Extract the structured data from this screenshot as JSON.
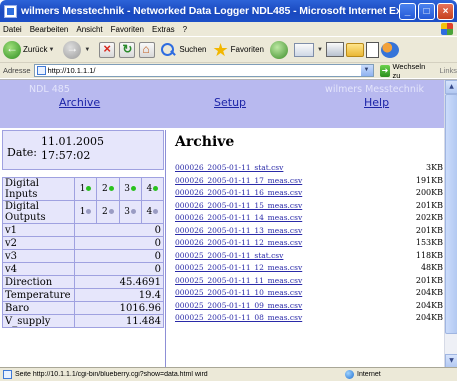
{
  "window": {
    "title": "wilmers Messtechnik - Networked Data Logger NDL485 - Microsoft Internet Explorer",
    "min": "_",
    "max": "□",
    "close": "×"
  },
  "menu": [
    "Datei",
    "Bearbeiten",
    "Ansicht",
    "Favoriten",
    "Extras",
    "?"
  ],
  "toolbar": {
    "back": "Zurück",
    "search": "Suchen",
    "favorites": "Favoriten"
  },
  "address": {
    "label": "Adresse",
    "url": "http://10.1.1.1/",
    "go": "Wechseln zu",
    "links": "Links"
  },
  "header": {
    "device": "NDL 485",
    "brand": "wilmers Messtechnik",
    "nav": {
      "archive": "Archive",
      "setup": "Setup",
      "help": "Help"
    }
  },
  "status_panel": {
    "date_label": "Date:",
    "date": "11.01.2005",
    "time": "17:57:02",
    "digital_inputs_label": "Digital Inputs",
    "digital_outputs_label": "Digital Outputs",
    "digital_inputs": [
      {
        "n": "1",
        "on": true
      },
      {
        "n": "2",
        "on": true
      },
      {
        "n": "3",
        "on": true
      },
      {
        "n": "4",
        "on": true
      }
    ],
    "digital_outputs": [
      {
        "n": "1",
        "on": false
      },
      {
        "n": "2",
        "on": false
      },
      {
        "n": "3",
        "on": false
      },
      {
        "n": "4",
        "on": false
      }
    ],
    "readings": [
      {
        "label": "v1",
        "value": "0"
      },
      {
        "label": "v2",
        "value": "0"
      },
      {
        "label": "v3",
        "value": "0"
      },
      {
        "label": "v4",
        "value": "0"
      },
      {
        "label": "Direction",
        "value": "45.4691"
      },
      {
        "label": "Temperature",
        "value": "19.4"
      },
      {
        "label": "Baro",
        "value": "1016.96"
      },
      {
        "label": "V_supply",
        "value": "11.484"
      }
    ]
  },
  "archive": {
    "title": "Archive",
    "files": [
      {
        "name": "000026_2005-01-11_stat.csv",
        "size": "3KB"
      },
      {
        "name": "000026_2005-01-11_17_meas.csv",
        "size": "191KB"
      },
      {
        "name": "000026_2005-01-11_16_meas.csv",
        "size": "200KB"
      },
      {
        "name": "000026_2005-01-11_15_meas.csv",
        "size": "201KB"
      },
      {
        "name": "000026_2005-01-11_14_meas.csv",
        "size": "202KB"
      },
      {
        "name": "000026_2005-01-11_13_meas.csv",
        "size": "201KB"
      },
      {
        "name": "000026_2005-01-11_12_meas.csv",
        "size": "153KB"
      },
      {
        "name": "000025_2005-01-11_stat.csv",
        "size": "118KB"
      },
      {
        "name": "000025_2005-01-11_12_meas.csv",
        "size": "48KB"
      },
      {
        "name": "000025_2005-01-11_11_meas.csv",
        "size": "201KB"
      },
      {
        "name": "000025_2005-01-11_10_meas.csv",
        "size": "204KB"
      },
      {
        "name": "000025_2005-01-11_09_meas.csv",
        "size": "204KB"
      },
      {
        "name": "000025_2005-01-11_08_meas.csv",
        "size": "204KB"
      }
    ]
  },
  "statusbar": {
    "text": "Seite http://10.1.1.1/cgi-bin/blueberry.cgi?show=data.html wird",
    "zone": "Internet"
  }
}
